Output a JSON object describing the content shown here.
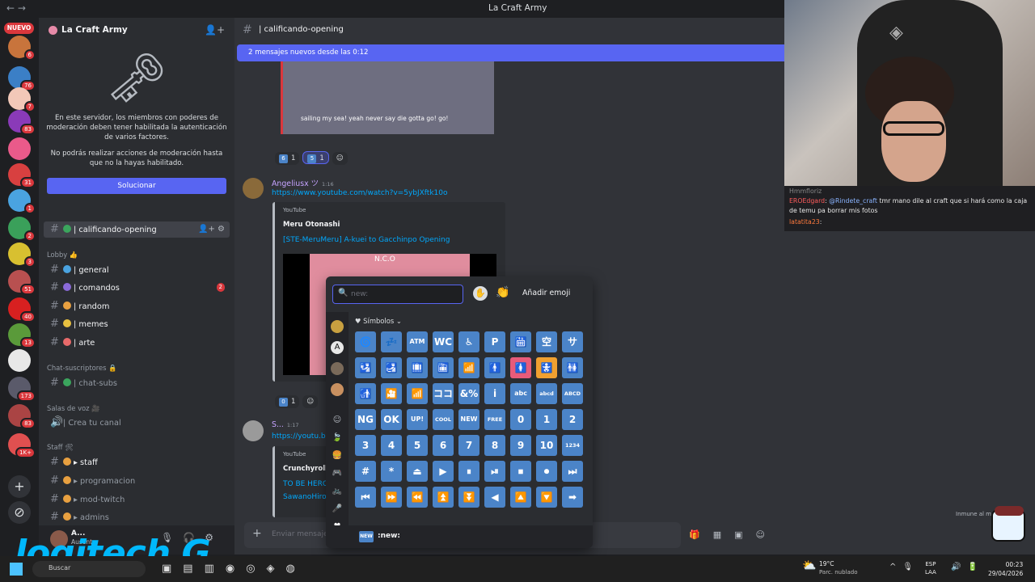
{
  "window": {
    "title": "La Craft Army"
  },
  "rail": {
    "nuevo": "NUEVO",
    "servers": [
      {
        "badge": "6",
        "color": "#c8743c"
      },
      {
        "badge": "76",
        "color": "#3b7fc6"
      },
      {
        "badge": "7",
        "color": "#f2c8b8"
      },
      {
        "badge": "83",
        "color": "#8a3ab8"
      },
      {
        "badge": "",
        "color": "#ea5a8a"
      },
      {
        "badge": "31",
        "color": "#d84040"
      },
      {
        "badge": "1",
        "color": "#4aa3e0"
      },
      {
        "badge": "2",
        "color": "#3aa05a"
      },
      {
        "badge": "3",
        "color": "#d8c030"
      },
      {
        "badge": "51",
        "color": "#b85050"
      },
      {
        "badge": "40",
        "color": "#d82020"
      },
      {
        "badge": "13",
        "color": "#5a9a3a"
      },
      {
        "badge": "",
        "color": "#e8e8e8"
      },
      {
        "badge": "173",
        "color": "#5a5a6a"
      },
      {
        "badge": "83",
        "color": "#aa4444"
      },
      {
        "badge": "1K+",
        "color": "#e05050"
      }
    ]
  },
  "server": {
    "name": "La Craft Army",
    "notice_text1": "En este servidor, los miembros con poderes de moderación deben tener habilitada la autenticación de varios factores.",
    "notice_text2": "No podrás realizar acciones de moderación hasta que no la hayas habilitado.",
    "notice_button": "Solucionar"
  },
  "channels": {
    "active": "| calificando-opening",
    "lobby_cat": "Lobby 👍",
    "general": "| general",
    "comandos": "| comandos",
    "comandos_badge": "2",
    "random": "| random",
    "memes": "| memes",
    "arte": "| arte",
    "subs_cat": "Chat-suscriptores 🔒",
    "chat_subs": "| chat-subs",
    "voice_cat": "Salas de voz 🎥",
    "crea_canal": "| Crea tu canal",
    "staff_cat": "Staff 🛠",
    "staff": "▸ staff",
    "programacion": "▸ programacion",
    "mod_twitch": "▸ mod-twitch",
    "admins": "▸ admins"
  },
  "user": {
    "name": "A...",
    "status": "Ausente"
  },
  "main": {
    "channel_name": "| calificando-opening",
    "new_messages": "2 mensajes nuevos desde las 0:12",
    "embed1_caption": "sailing my sea! yeah never say die gotta go! go!",
    "reactions1": [
      {
        "emoji": "6",
        "count": "1",
        "on": false
      },
      {
        "emoji": "5",
        "count": "1",
        "on": true
      }
    ],
    "msg2_author": "Angeliusx ツ",
    "msg2_time": "1:16",
    "msg2_link": "https://www.youtube.com/watch?v=5ybJXftk10o",
    "embed2_provider": "YouTube",
    "embed2_author": "Meru Otonashi",
    "embed2_title": "[STE-MeruMeru] A-kuei to Gacchinpo Opening",
    "embed2_thumb_text": "N.C.O",
    "reactions2": [
      {
        "emoji": "0",
        "count": "1"
      }
    ],
    "msg3_author": "S...",
    "msg3_time": "1:17",
    "msg3_link": "https://youtu.b",
    "embed3_provider": "YouTube",
    "embed3_author": "Crunchyroll",
    "embed3_title": "TO BE HERO",
    "embed3_sub": "SawanoHiro",
    "input_placeholder": "Enviar mensaje"
  },
  "picker": {
    "search_value": "",
    "search_placeholder": "new:",
    "add_emoji": "Añadir emoji",
    "category": "Símbolos",
    "footer_icon": "NEW",
    "footer_name": ":new:",
    "tiles": [
      [
        "🌀",
        "💤",
        "ATM",
        "WC",
        "♿",
        "P",
        "🛗",
        "空",
        "サ"
      ],
      [
        "🛂",
        "🛃",
        "🛄",
        "🛅",
        "📶",
        "🚹",
        "🚺",
        "🚼",
        "🚻"
      ],
      [
        "🚮",
        "🎦",
        "📶",
        "ココ",
        "&%",
        "i",
        "abc",
        "abcd",
        "ABCD"
      ],
      [
        "NG",
        "OK",
        "UP!",
        "COOL",
        "NEW",
        "FREE",
        "0",
        "1",
        "2"
      ],
      [
        "3",
        "4",
        "5",
        "6",
        "7",
        "8",
        "9",
        "10",
        "1234"
      ],
      [
        "#",
        "*",
        "⏏",
        "▶",
        "⏸",
        "⏯",
        "⏹",
        "⏺",
        "⏭"
      ],
      [
        "⏮",
        "⏩",
        "⏪",
        "⏫",
        "⏬",
        "◀",
        "🔼",
        "🔽",
        "➡"
      ]
    ]
  },
  "stream_chat": {
    "line1_user": "EROEdgard",
    "line1_mention": "@Rindete_craft",
    "line1_text": "tmr mano dile al craft que si hará como la caja de temu pa borrar mis fotos",
    "line2_user": "latatita23",
    "line0_user": "Hmmfloriz"
  },
  "overlay": {
    "inmune": "Inmune al m",
    "logo": "logitech G"
  },
  "taskbar": {
    "search": "Buscar",
    "temp": "19°C",
    "condition": "Parc. nublado",
    "lang1": "ESP",
    "lang2": "LAA",
    "time": "00:23",
    "date": "29/04/2026"
  },
  "colors": {
    "accent": "#5865f2",
    "tile": "#4b84c8",
    "link": "#00a8fc"
  }
}
